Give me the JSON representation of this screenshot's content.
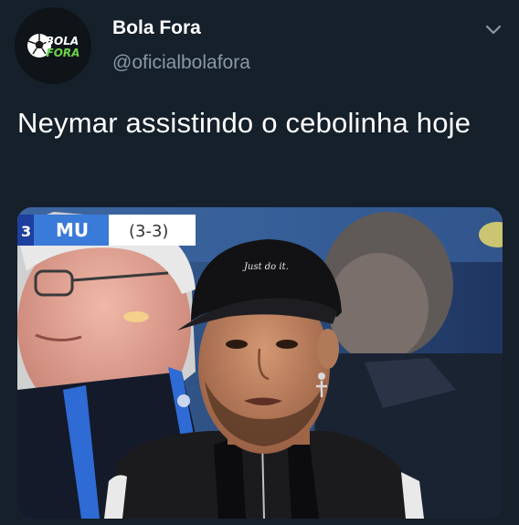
{
  "author": {
    "display_name": "Bola Fora",
    "handle": "@oficialbolafora",
    "avatar_logo_text_top": "BOLA",
    "avatar_logo_text_bottom": "FORA"
  },
  "tweet": {
    "text": "Neymar assistindo o cebolinha hoje"
  },
  "media": {
    "scoreboard": {
      "left_fragment": "3",
      "team": "MU",
      "score": "(3-3)"
    },
    "cap_text": "Just do it."
  },
  "icons": {
    "menu": "chevron-down-icon",
    "logo": "soccer-ball-icon"
  },
  "colors": {
    "background": "#15202b",
    "secondary_text": "#8899a6",
    "logo_green": "#6bd14a"
  }
}
